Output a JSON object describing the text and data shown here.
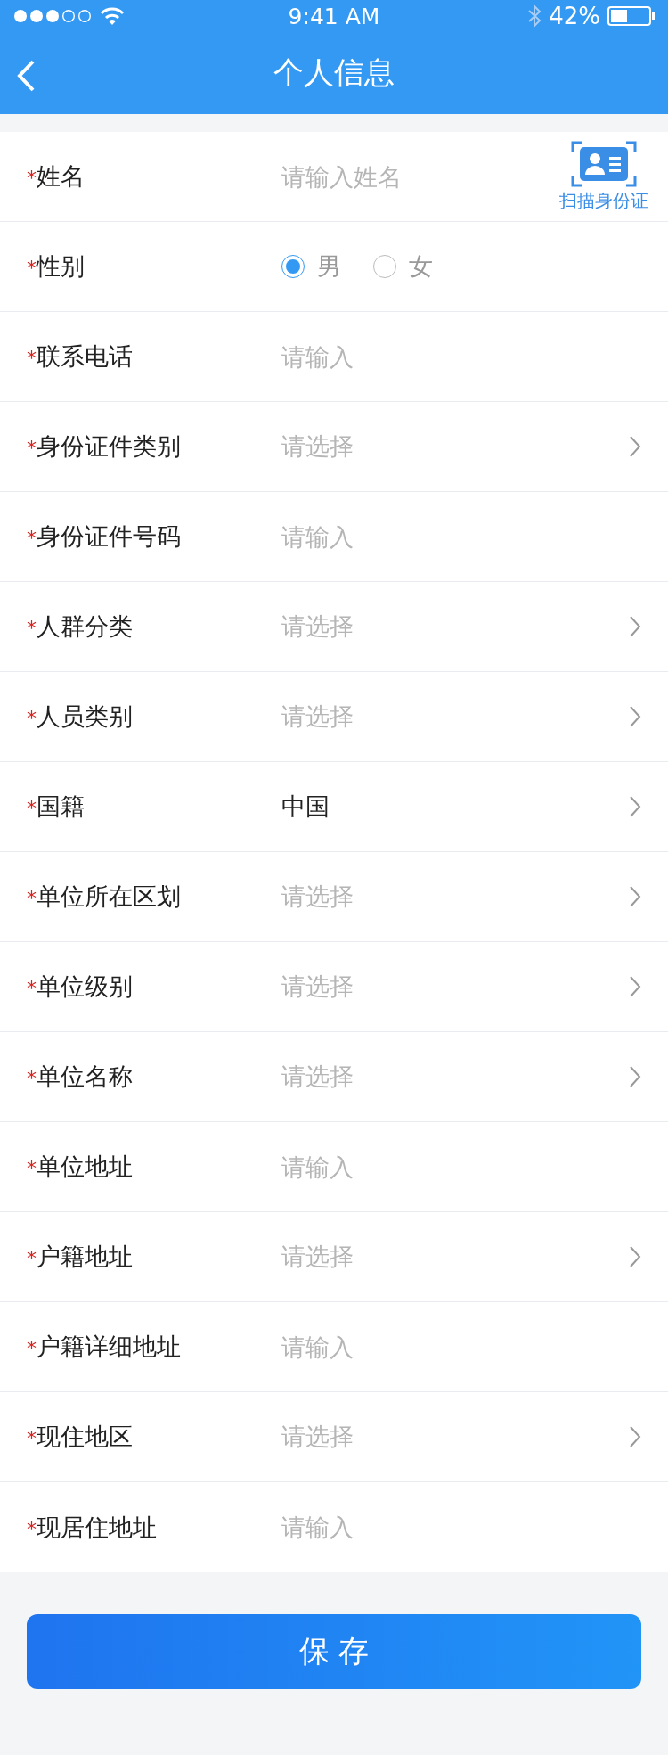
{
  "status_bar": {
    "time": "9:41 AM",
    "battery": "42%"
  },
  "nav": {
    "title": "个人信息"
  },
  "fields": [
    {
      "kind": "input",
      "required_mark": "*",
      "label": "姓名",
      "placeholder": "请输入姓名",
      "scan_button": {
        "label": "扫描身份证"
      }
    },
    {
      "kind": "radio",
      "required_mark": "*",
      "label": "性别",
      "options": [
        {
          "label": "男",
          "selected": true
        },
        {
          "label": "女",
          "selected": false
        }
      ]
    },
    {
      "kind": "input",
      "required_mark": "*",
      "label": "联系电话",
      "placeholder": "请输入"
    },
    {
      "kind": "select",
      "required_mark": "*",
      "label": "身份证件类别",
      "placeholder": "请选择"
    },
    {
      "kind": "input",
      "required_mark": "*",
      "label": "身份证件号码",
      "placeholder": "请输入"
    },
    {
      "kind": "select",
      "required_mark": "*",
      "label": "人群分类",
      "placeholder": "请选择"
    },
    {
      "kind": "select",
      "required_mark": "*",
      "label": "人员类别",
      "placeholder": "请选择"
    },
    {
      "kind": "select",
      "required_mark": "*",
      "label": "国籍",
      "value": "中国"
    },
    {
      "kind": "select",
      "required_mark": "*",
      "label": "单位所在区划",
      "placeholder": "请选择"
    },
    {
      "kind": "select",
      "required_mark": "*",
      "label": "单位级别",
      "placeholder": "请选择"
    },
    {
      "kind": "select",
      "required_mark": "*",
      "label": "单位名称",
      "placeholder": "请选择"
    },
    {
      "kind": "input",
      "required_mark": "*",
      "label": "单位地址",
      "placeholder": "请输入"
    },
    {
      "kind": "select",
      "required_mark": "*",
      "label": "户籍地址",
      "placeholder": "请选择"
    },
    {
      "kind": "input",
      "required_mark": "*",
      "label": "户籍详细地址",
      "placeholder": "请输入"
    },
    {
      "kind": "select",
      "required_mark": "*",
      "label": "现住地区",
      "placeholder": "请选择"
    },
    {
      "kind": "input",
      "required_mark": "*",
      "label": "现居住地址",
      "placeholder": "请输入"
    }
  ],
  "save_button": {
    "label": "保 存"
  }
}
